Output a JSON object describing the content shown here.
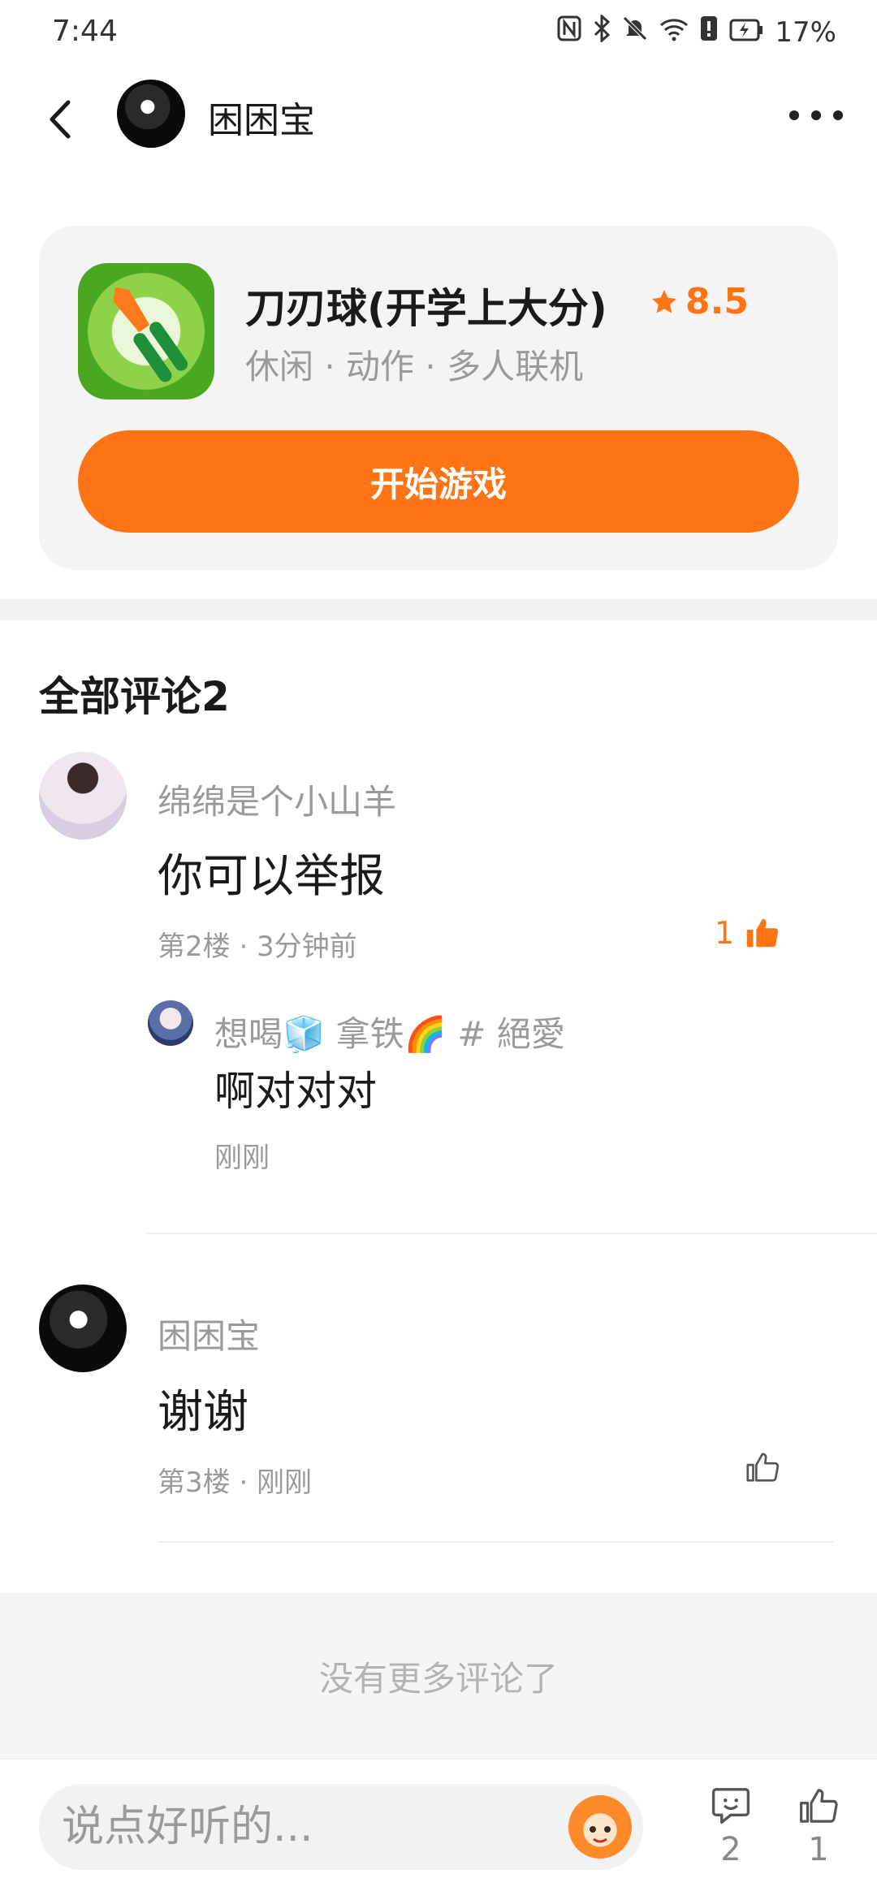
{
  "status_bar": {
    "time": "7:44",
    "battery": "17%",
    "icons": [
      "nfc-icon",
      "bluetooth-icon",
      "bell-off-icon",
      "wifi-icon",
      "alert-icon",
      "battery-charging-icon"
    ]
  },
  "header": {
    "title": "困困宝"
  },
  "game": {
    "name": "刀刃球(开学上大分)",
    "rating": "8.5",
    "tags": "休闲 · 动作 · 多人联机",
    "start_button": "开始游戏",
    "accent_color": "#ff7414"
  },
  "comments_section": {
    "title": "全部评论2",
    "comments": [
      {
        "username": "绵绵是个小山羊",
        "text": "你可以举报",
        "meta": "第2楼 · 3分钟前",
        "likes": "1",
        "liked": true,
        "reply": {
          "username": "想喝🧊 拿铁🌈 # 絕愛",
          "text": "啊对对对",
          "time": "刚刚"
        }
      },
      {
        "username": "困困宝",
        "text": "谢谢",
        "meta": "第3楼 · 刚刚",
        "liked": false
      }
    ],
    "no_more": "没有更多评论了"
  },
  "bottom_bar": {
    "placeholder": "说点好听的...",
    "comment_count": "2",
    "like_count": "1"
  }
}
